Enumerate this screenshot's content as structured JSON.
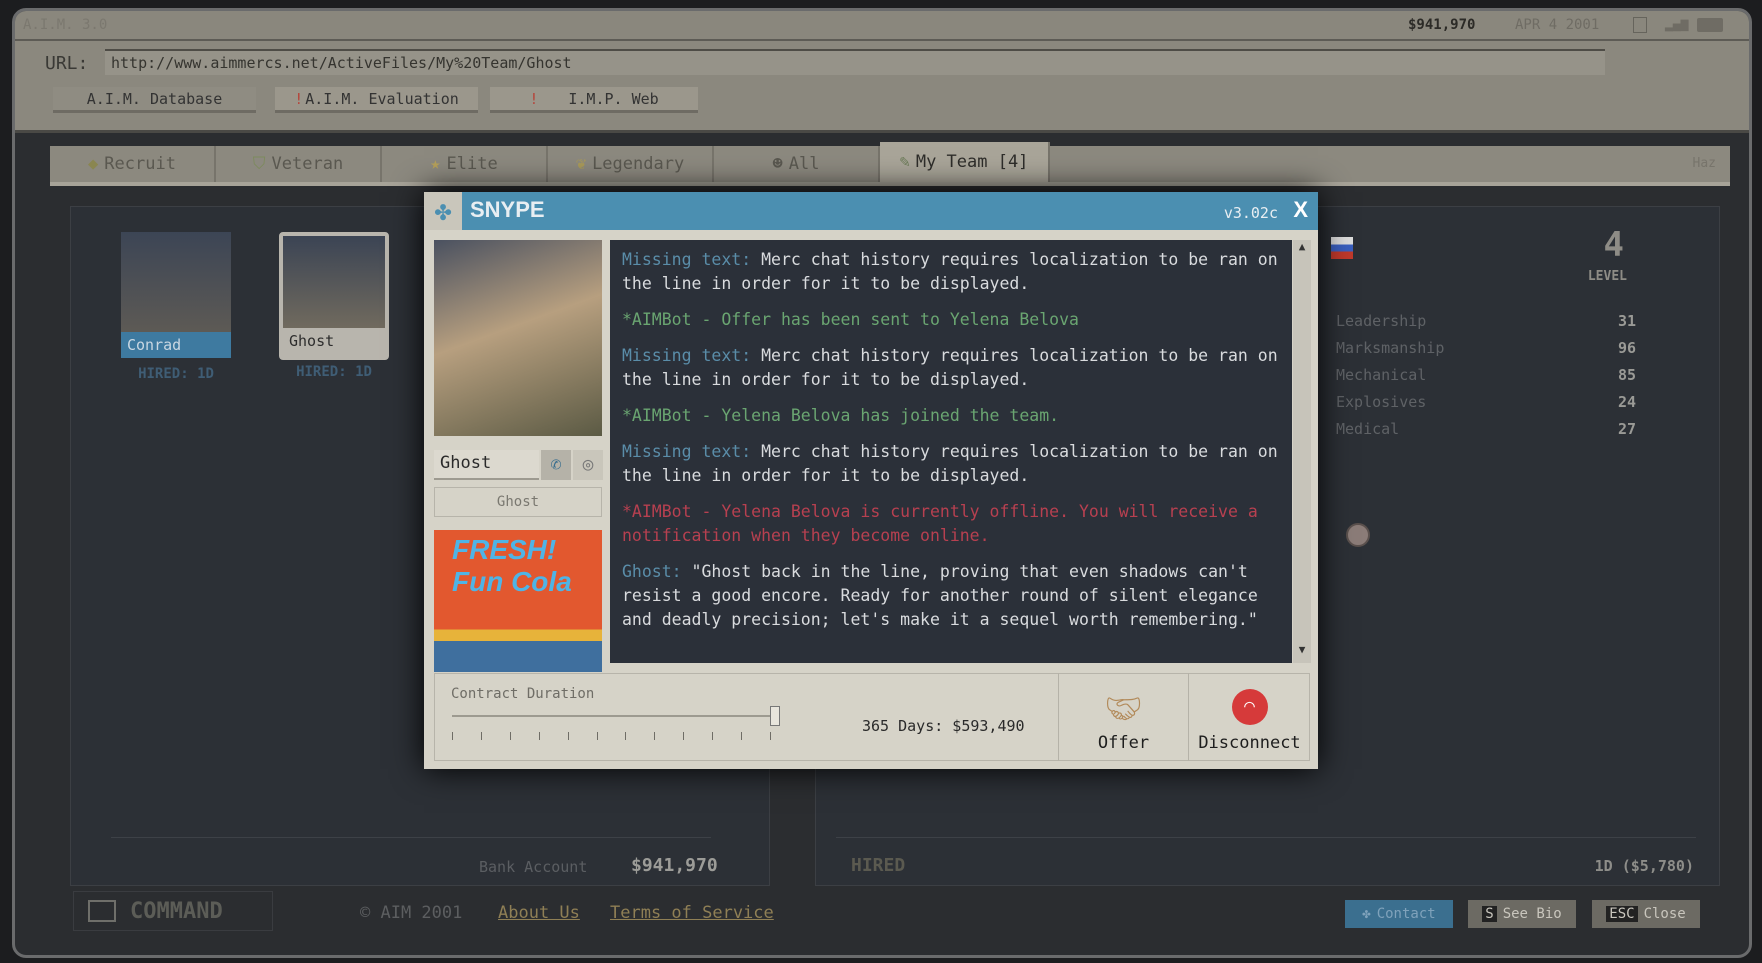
{
  "topbar": {
    "title": "A.I.M. 3.0",
    "balance": "$941,970",
    "date": "APR 4 2001"
  },
  "url": {
    "label": "URL:",
    "value": "http://www.aimmercs.net/ActiveFiles/My%20Team/Ghost"
  },
  "nav": [
    {
      "label": "A.I.M. Database",
      "alert": ""
    },
    {
      "label": "A.I.M. Evaluation",
      "alert": "!"
    },
    {
      "label": "I.M.P. Web",
      "alert": "!"
    }
  ],
  "tabs": [
    {
      "label": "Recruit",
      "icon": "recruit-icon"
    },
    {
      "label": "Veteran",
      "icon": "chevron-icon"
    },
    {
      "label": "Elite",
      "icon": "star-icon"
    },
    {
      "label": "Legendary",
      "icon": "wings-icon"
    },
    {
      "label": "All",
      "icon": "group-icon"
    },
    {
      "label": "My Team [4]",
      "icon": "money-icon"
    }
  ],
  "hazmat_logo": "Haz",
  "team": [
    {
      "name": "Conrad",
      "hired": "HIRED: 1D"
    },
    {
      "name": "Ghost",
      "hired": "HIRED: 1D"
    }
  ],
  "profile": {
    "level": "4",
    "level_label": "LEVEL",
    "skills": [
      {
        "name": "Leadership",
        "value": "31"
      },
      {
        "name": "Marksmanship",
        "value": "96"
      },
      {
        "name": "Mechanical",
        "value": "85"
      },
      {
        "name": "Explosives",
        "value": "24"
      },
      {
        "name": "Medical",
        "value": "27"
      }
    ],
    "hired_label": "HIRED",
    "hired_value": "1D ($5,780)"
  },
  "bank": {
    "label": "Bank Account",
    "value": "$941,970"
  },
  "footer": {
    "command": "COMMAND",
    "copyright": "© AIM 2001",
    "about": "About Us",
    "terms": "Terms of Service",
    "contact": "Contact",
    "see_bio_key": "S",
    "see_bio": "See Bio",
    "close_key": "ESC",
    "close": "Close"
  },
  "snype": {
    "title": "SNYPE",
    "version": "v3.02c",
    "close": "X",
    "contact_name": "Ghost",
    "contact_sub": "Ghost",
    "ad_text": "FRESH! Fun Cola",
    "messages": [
      {
        "prefix": "Missing text:",
        "text": " Merc chat history requires localization to be ran on the line in order for it to be displayed.",
        "type": "missing"
      },
      {
        "prefix": "",
        "text": "*AIMBot - Offer has been sent to Yelena Belova",
        "type": "green"
      },
      {
        "prefix": "Missing text:",
        "text": " Merc chat history requires localization to be ran on the line in order for it to be displayed.",
        "type": "missing"
      },
      {
        "prefix": "",
        "text": "*AIMBot - Yelena Belova has joined the team.",
        "type": "green"
      },
      {
        "prefix": "Missing text:",
        "text": " Merc chat history requires localization to be ran on the line in order for it to be displayed.",
        "type": "missing"
      },
      {
        "prefix": "",
        "text": "*AIMBot - Yelena Belova is currently offline. You will receive a notification when they become online.",
        "type": "red"
      },
      {
        "prefix": "Ghost:",
        "text": " \"Ghost back in the line, proving that even shadows can't resist a good encore. Ready for another round of silent elegance and deadly precision; let's make it a sequel worth remembering.\"",
        "type": "missing"
      }
    ],
    "contract_label": "Contract Duration",
    "contract_value": "365 Days: $593,490",
    "slider_fraction": 1.0,
    "offer": "Offer",
    "disconnect": "Disconnect"
  },
  "colors": {
    "accent": "#4b8fb1",
    "green": "#6aa571",
    "red": "#b74050"
  }
}
